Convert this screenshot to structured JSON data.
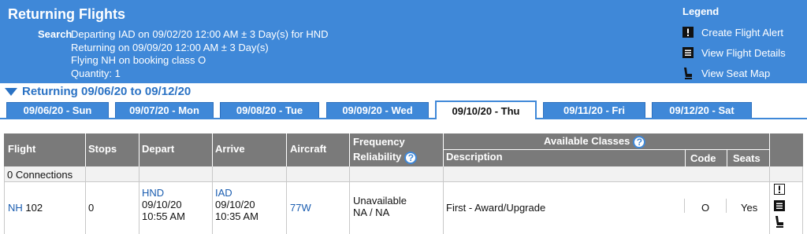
{
  "header": {
    "title": "Returning Flights",
    "search_label": "Search",
    "search_lines": [
      "Departing IAD on 09/02/20 12:00 AM ± 3 Day(s) for HND",
      "Returning on 09/09/20 12:00 AM ± 3 Day(s)",
      "Flying NH on booking class O",
      "Quantity: 1"
    ]
  },
  "legend": {
    "title": "Legend",
    "items": [
      {
        "icon": "alert-icon",
        "label": "Create Flight Alert"
      },
      {
        "icon": "details-icon",
        "label": "View Flight Details"
      },
      {
        "icon": "seat-icon",
        "label": "View Seat Map"
      }
    ]
  },
  "range_label": "Returning 09/06/20 to 09/12/20",
  "tabs": [
    {
      "label": "09/06/20 - Sun",
      "active": false
    },
    {
      "label": "09/07/20 - Mon",
      "active": false
    },
    {
      "label": "09/08/20 - Tue",
      "active": false
    },
    {
      "label": "09/09/20 - Wed",
      "active": false
    },
    {
      "label": "09/10/20 - Thu",
      "active": true
    },
    {
      "label": "09/11/20 - Fri",
      "active": false
    },
    {
      "label": "09/12/20 - Sat",
      "active": false
    }
  ],
  "table": {
    "headers": {
      "flight": "Flight",
      "stops": "Stops",
      "depart": "Depart",
      "arrive": "Arrive",
      "aircraft": "Aircraft",
      "frequency": "Frequency",
      "reliability": "Reliability",
      "available_classes": "Available Classes",
      "description": "Description",
      "code": "Code",
      "seats": "Seats"
    },
    "connections_label": "0 Connections",
    "rows": [
      {
        "airline": "NH",
        "flight_number": "102",
        "stops": "0",
        "depart_airport": "HND",
        "depart_date": "09/10/20",
        "depart_time": "10:55 AM",
        "arrive_airport": "IAD",
        "arrive_date": "09/10/20",
        "arrive_time": "10:35 AM",
        "aircraft": "77W",
        "frequency": "Unavailable",
        "reliability": "NA / NA",
        "description": "First - Award/Upgrade",
        "code": "O",
        "seats": "Yes"
      }
    ]
  },
  "colors": {
    "header_bg": "#3f88d8",
    "table_header_bg": "#7a7a7a",
    "link": "#1a5db0"
  }
}
